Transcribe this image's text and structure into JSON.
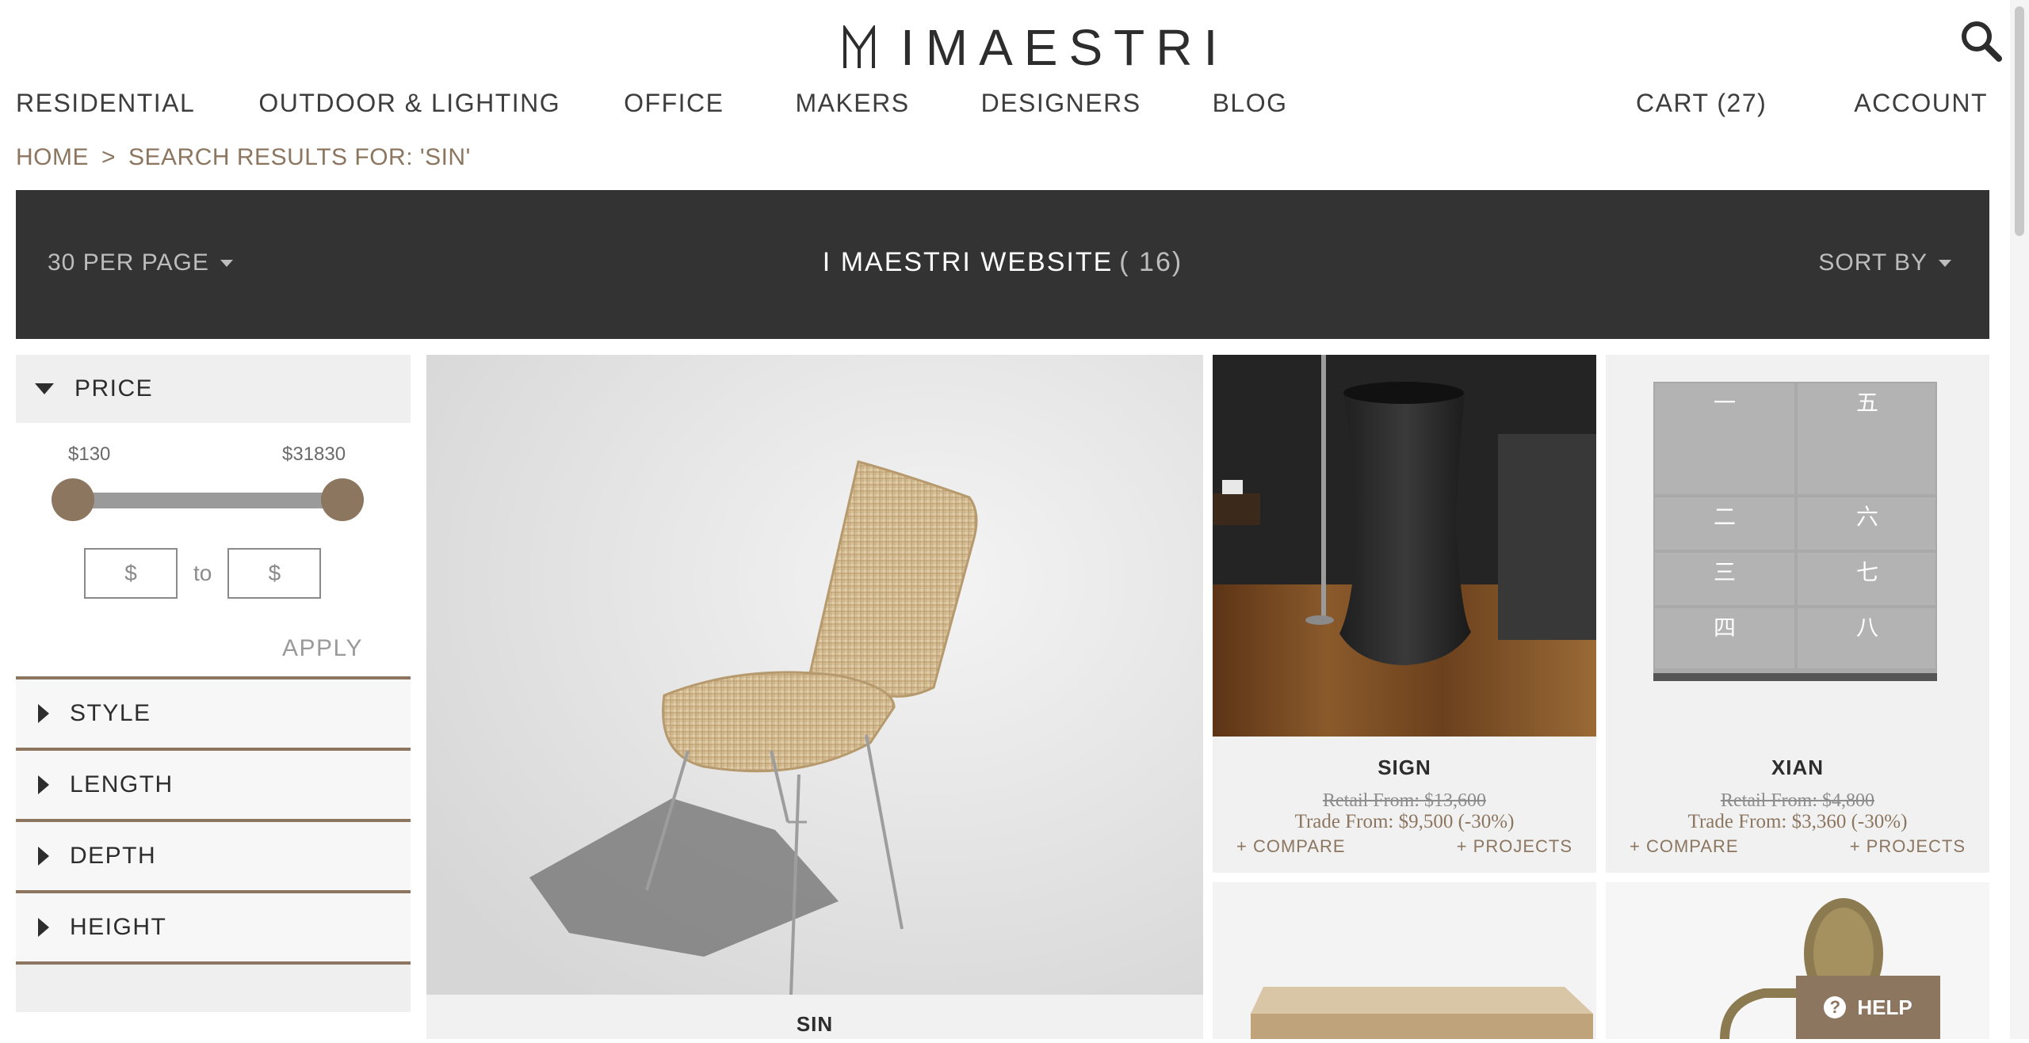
{
  "brand": {
    "logo_text": "IMAESTRI",
    "accent_color": "#8c7660",
    "dark_bar_color": "#333333"
  },
  "header": {
    "search_icon": "search-icon"
  },
  "nav": {
    "left": [
      "RESIDENTIAL",
      "OUTDOOR & LIGHTING",
      "OFFICE",
      "MAKERS",
      "DESIGNERS",
      "BLOG"
    ],
    "cart": "CART (27)",
    "account": "ACCOUNT"
  },
  "breadcrumb": {
    "home": "HOME",
    "separator": ">",
    "current": "SEARCH RESULTS FOR: 'SIN'"
  },
  "toolbar": {
    "per_page": "30 PER PAGE",
    "title": "I MAESTRI WEBSITE",
    "count": "( 16)",
    "sort_by": "SORT BY"
  },
  "filters": {
    "price": {
      "title": "PRICE",
      "min_label": "$130",
      "max_label": "$31830",
      "range_low_fraction": 0,
      "range_high_fraction": 1,
      "from_placeholder": "$",
      "to_label": "to",
      "to_placeholder": "$",
      "apply": "APPLY"
    },
    "collapsed": [
      "STYLE",
      "LENGTH",
      "DEPTH",
      "HEIGHT"
    ]
  },
  "products": [
    {
      "name": "SIN"
    },
    {
      "name": "SIGN",
      "retail": "Retail From: $13,600",
      "trade": "Trade From: $9,500 (-30%)",
      "compare": "+ COMPARE",
      "projects": "+ PROJECTS"
    },
    {
      "name": "XIAN",
      "retail": "Retail From: $4,800",
      "trade": "Trade From: $3,360 (-30%)",
      "compare": "+ COMPARE",
      "projects": "+ PROJECTS",
      "panel_chars": [
        "一",
        "五",
        "二",
        "六",
        "三",
        "七",
        "四",
        "八"
      ]
    }
  ],
  "help": {
    "label": "HELP",
    "icon_glyph": "?"
  }
}
